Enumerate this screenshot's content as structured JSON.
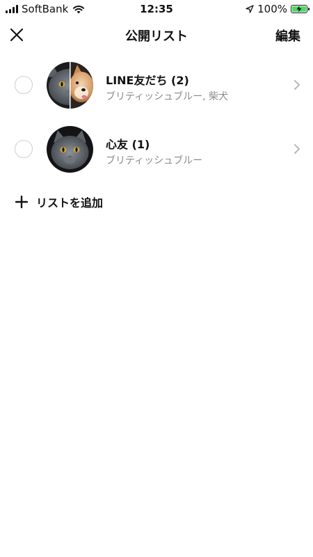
{
  "status_bar": {
    "carrier": "SoftBank",
    "time": "12:35",
    "battery_percent": "100%"
  },
  "nav": {
    "title": "公開リスト",
    "edit_label": "編集"
  },
  "lists": [
    {
      "title": "LINE友だち (2)",
      "subtitle": "ブリティッシュブルー, 柴犬",
      "avatar": "split-cat-dog"
    },
    {
      "title": "心友 (1)",
      "subtitle": "ブリティッシュブルー",
      "avatar": "cat"
    }
  ],
  "add_list_label": "リストを追加",
  "icons": {
    "close": "close-icon",
    "chevron": "chevron-right-icon",
    "add": "plus-icon"
  },
  "colors": {
    "battery_fill": "#4cd964",
    "subtitle_gray": "#8a8a8a",
    "radio_border": "#cfcfcf"
  }
}
